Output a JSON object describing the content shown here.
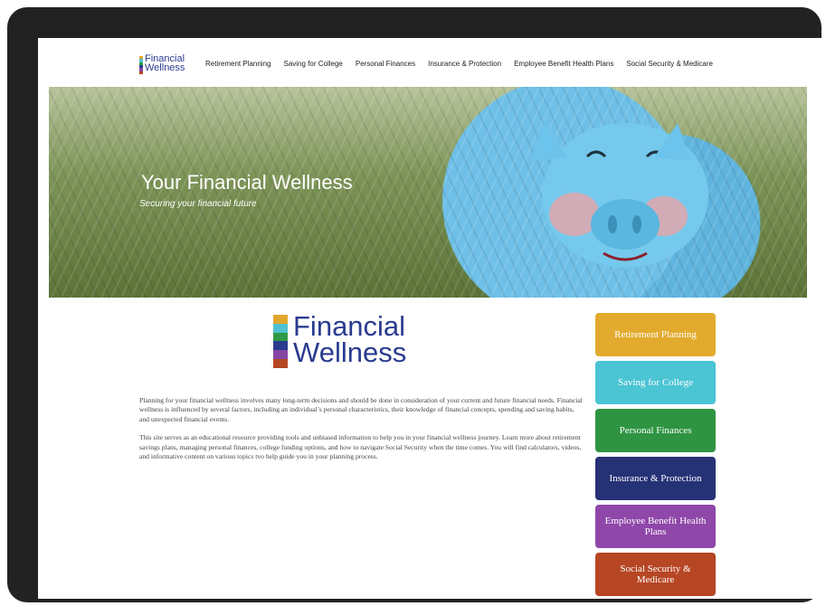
{
  "header": {
    "logo": {
      "line1": "Financial",
      "line2": "Wellness",
      "bar_colors": [
        "#e3a62d",
        "#4fc1d0",
        "#2f9a44",
        "#2a3b8f",
        "#8647a4",
        "#b34822"
      ]
    },
    "menu": [
      "Retirement Planning",
      "Saving for College",
      "Personal Finances",
      "Insurance & Protection",
      "Employee Benefit Health Plans",
      "Social Security & Medicare"
    ],
    "search_icon": "search-icon"
  },
  "hero": {
    "title": "Your Financial Wellness",
    "subtitle": "Securing your financial future"
  },
  "content": {
    "logo": {
      "line1": "Financial",
      "line2": "Wellness",
      "bar_colors": [
        "#e3a62d",
        "#4fc1d0",
        "#2f9a44",
        "#2a3b8f",
        "#8647a4",
        "#b34822"
      ]
    },
    "paragraphs": [
      "Planning for your financial wellness involves many long-term decisions and should be done in consideration of your current and future financial needs. Financial wellness is influenced by several factors, including an individual’s personal characteristics, their knowledge of financial concepts, spending and saving habits, and unexpected financial events.",
      "This site serves as an educational resource providing tools and unbiased information to help you in your financial wellness journey. Learn more about retirement savings plans, managing personal finances, college funding options, and how to navigate Social Security when the time comes. You will find calculators, videos, and informative content on various topics tvo help guide you in your planning process."
    ]
  },
  "side_buttons": [
    {
      "label": "Retirement Planning",
      "color": "#e2ab2e"
    },
    {
      "label": "Saving for College",
      "color": "#4bc4d4"
    },
    {
      "label": "Personal Finances",
      "color": "#2e9441"
    },
    {
      "label": "Insurance & Protection",
      "color": "#263276"
    },
    {
      "label": "Employee Benefit Health Plans",
      "color": "#8f47a9"
    },
    {
      "label": "Social Security & Medicare",
      "color": "#b64624"
    }
  ]
}
